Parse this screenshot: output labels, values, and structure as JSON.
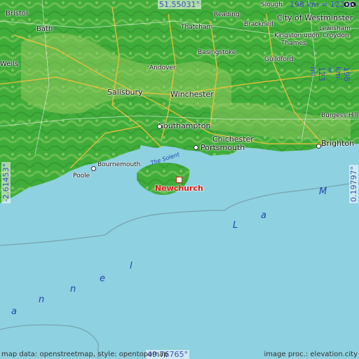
{
  "map": {
    "marker": {
      "name": "Newchurch"
    },
    "coordinates": {
      "top_lat": "51.55031°",
      "bottom_lat": "49.76765°",
      "left_lon": "-2.61453°",
      "right_lon": "0.19797°"
    },
    "scale": {
      "horizontal": "198 km = 123 mi",
      "vertical": "198 km = 123 mi"
    },
    "sea_label_letters": [
      "a",
      "n",
      "n",
      "e",
      "l",
      "L",
      "a",
      "M"
    ],
    "solent_label": "The Solent",
    "places": [
      {
        "id": "bristol",
        "label": "Bristol"
      },
      {
        "id": "bath",
        "label": "Bath"
      },
      {
        "id": "wells",
        "label": "Wells"
      },
      {
        "id": "salisbury",
        "label": "Salisbury"
      },
      {
        "id": "andover",
        "label": "Andover"
      },
      {
        "id": "winchester",
        "label": "Winchester"
      },
      {
        "id": "basingstoke",
        "label": "Basingstoke"
      },
      {
        "id": "reading",
        "label": "Reading"
      },
      {
        "id": "thatcham",
        "label": "Thatcham"
      },
      {
        "id": "bracknell",
        "label": "Bracknell"
      },
      {
        "id": "slough",
        "label": "Slough"
      },
      {
        "id": "westminster",
        "label": "City of Westminster"
      },
      {
        "id": "lewisham",
        "label": "Lewisham"
      },
      {
        "id": "kingston",
        "label": "Kingston upon"
      },
      {
        "id": "croydon",
        "label": "Croydon"
      },
      {
        "id": "thames",
        "label": "Thames"
      },
      {
        "id": "guildford",
        "label": "Guildford"
      },
      {
        "id": "southampton",
        "label": "Southampton"
      },
      {
        "id": "chichester",
        "label": "Chichester"
      },
      {
        "id": "portsmouth",
        "label": "Portsmouth"
      },
      {
        "id": "brighton",
        "label": "Brighton"
      },
      {
        "id": "burgesshill",
        "label": "Burgess Hill"
      },
      {
        "id": "bournemouth",
        "label": "Bournemouth"
      },
      {
        "id": "poole",
        "label": "Poole"
      },
      {
        "id": "london_partial",
        "label": "oo"
      }
    ],
    "footer": {
      "left": "map data: openstreetmap, style: opentopomap",
      "right": "image proc.: elevation.city"
    },
    "colors": {
      "sea": "#8ed1e0",
      "lowland": "#3fae3a",
      "highland": "#9ccf6a",
      "marker": "#e01818",
      "coord_text": "#3d4fbf"
    }
  }
}
